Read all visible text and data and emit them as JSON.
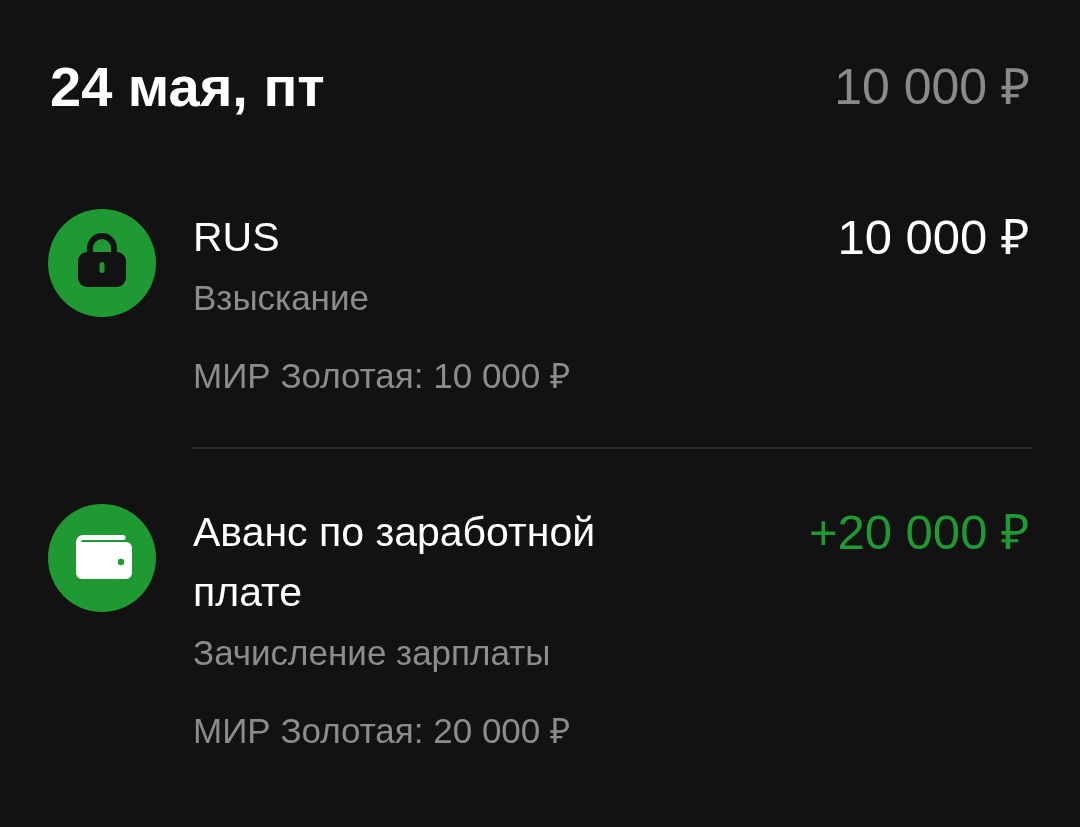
{
  "day": {
    "date": "24 мая, пт",
    "total": "10 000 ₽"
  },
  "transactions": [
    {
      "kind": "hold",
      "title": "RUS",
      "category": "Взыскание",
      "card": "МИР Золотая: 10 000 ₽",
      "amount": "10 000 ₽"
    },
    {
      "kind": "income",
      "title": "Аванс по заработной плате",
      "category": "Зачисление зарплаты",
      "card": "МИР Золотая: 20 000 ₽",
      "amount": "+20 000 ₽"
    }
  ]
}
